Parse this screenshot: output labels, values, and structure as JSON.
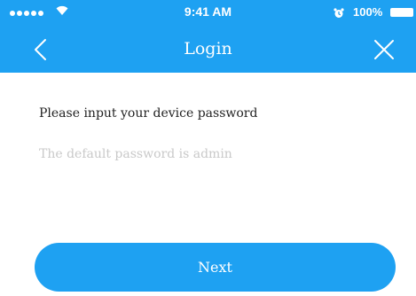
{
  "status_bar": {
    "time": "9:41 AM",
    "battery_percent": "100%"
  },
  "nav": {
    "title": "Login",
    "back_icon": "chevron-left-icon",
    "close_icon": "close-icon"
  },
  "form": {
    "prompt": "Please input your device password",
    "password_placeholder": "The default password is admin",
    "password_value": ""
  },
  "actions": {
    "next_label": "Next"
  },
  "colors": {
    "accent": "#1ea1f2",
    "placeholder": "#c9c9c9",
    "text": "#222222"
  }
}
